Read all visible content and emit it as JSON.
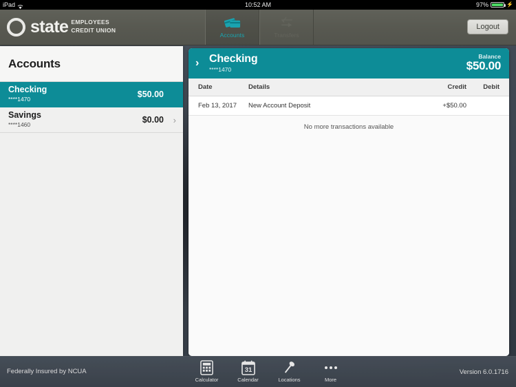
{
  "status_bar": {
    "device": "iPad",
    "wifi_icon": "wifi-icon",
    "time": "10:52 AM",
    "battery_percent": "97%",
    "battery_icon": "battery-charging-icon"
  },
  "nav": {
    "brand": {
      "logo_icon": "state-employees-credit-union-ring-logo",
      "name": "state",
      "sub_line1": "EMPLOYEES",
      "sub_line2": "CREDIT UNION"
    },
    "tabs": [
      {
        "label": "Accounts",
        "icon": "credit-cards-icon",
        "active": true
      },
      {
        "label": "Transfers",
        "icon": "transfer-arrows-icon",
        "active": false
      }
    ],
    "logout_label": "Logout"
  },
  "sidebar": {
    "title": "Accounts",
    "accounts": [
      {
        "name": "Checking",
        "mask": "****1470",
        "amount": "$50.00",
        "selected": true,
        "chevron": "›"
      },
      {
        "name": "Savings",
        "mask": "****1460",
        "amount": "$0.00",
        "selected": false,
        "chevron": "›"
      }
    ]
  },
  "detail": {
    "chevron": "›",
    "title": "Checking",
    "mask": "****1470",
    "balance_label": "Balance",
    "balance_amount": "$50.00",
    "columns": {
      "date": "Date",
      "details": "Details",
      "credit": "Credit",
      "debit": "Debit"
    },
    "transactions": [
      {
        "date": "Feb 13, 2017",
        "details": "New Account Deposit",
        "credit": "+$50.00",
        "debit": ""
      }
    ],
    "empty_note": "No more transactions available"
  },
  "bottom": {
    "ncua_text": "Federally Insured by NCUA",
    "version_text": "Version 6.0.1716",
    "tools": [
      {
        "label": "Calculator",
        "icon": "calculator-icon"
      },
      {
        "label": "Calendar",
        "icon": "calendar-icon",
        "day": "31"
      },
      {
        "label": "Locations",
        "icon": "map-pin-icon"
      },
      {
        "label": "More",
        "icon": "ellipsis-icon"
      }
    ]
  },
  "colors": {
    "teal": "#0d8c97",
    "navbar": "#585951",
    "battery_green": "#4cd964"
  }
}
